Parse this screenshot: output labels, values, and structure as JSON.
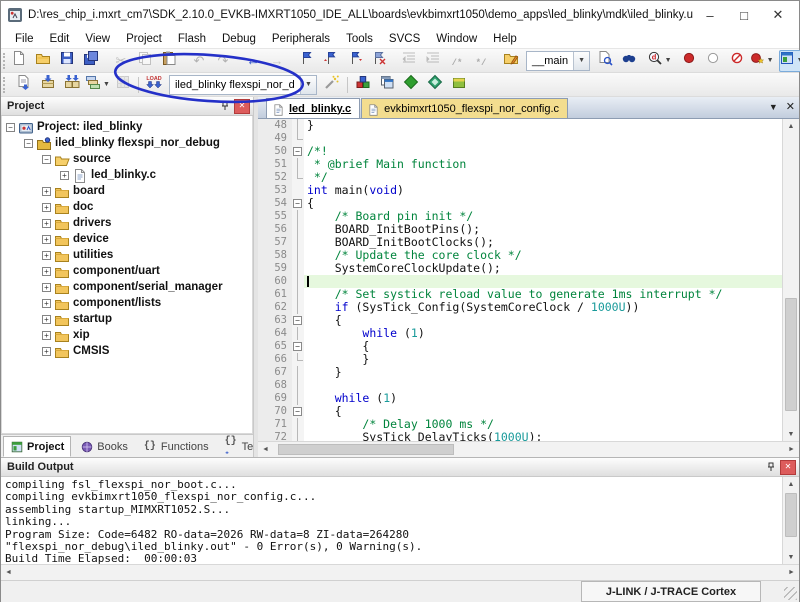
{
  "window": {
    "title": "D:\\res_chip_i.mxrt_cm7\\SDK_2.10.0_EVKB-IMXRT1050_IDE_ALL\\boards\\evkbimxrt1050\\demo_apps\\led_blinky\\mdk\\iled_blinky.uvprojx - µVision",
    "controls": [
      {
        "name": "minimize",
        "glyph": "–"
      },
      {
        "name": "maximize",
        "glyph": "□"
      },
      {
        "name": "close",
        "glyph": "✕"
      }
    ]
  },
  "menu": [
    "File",
    "Edit",
    "View",
    "Project",
    "Flash",
    "Debug",
    "Peripherals",
    "Tools",
    "SVCS",
    "Window",
    "Help"
  ],
  "toolbars": {
    "row1": [
      {
        "grip": 1
      },
      {
        "name": "new-file",
        "icon": "pageNew"
      },
      {
        "name": "open-file",
        "icon": "folderOpen"
      },
      {
        "name": "save",
        "icon": "floppy"
      },
      {
        "name": "save-all",
        "icon": "floppyAll"
      },
      {
        "sep": 1
      },
      {
        "name": "cut",
        "icon": "scissors",
        "disabled": 1
      },
      {
        "name": "copy",
        "icon": "copy",
        "disabled": 1
      },
      {
        "name": "paste",
        "icon": "paste"
      },
      {
        "sep": 1
      },
      {
        "name": "undo",
        "icon": "undo",
        "disabled": 1
      },
      {
        "name": "redo",
        "icon": "redo",
        "disabled": 1
      },
      {
        "sep": 1
      },
      {
        "name": "navigate-back",
        "icon": "navBack"
      },
      {
        "name": "navigate-forward",
        "icon": "navFwd",
        "disabled": 1
      },
      {
        "sep": 1
      },
      {
        "name": "toggle-bookmark",
        "icon": "flag"
      },
      {
        "name": "prev-bookmark",
        "icon": "flagPrev"
      },
      {
        "name": "next-bookmark",
        "icon": "flagNext"
      },
      {
        "name": "clear-bookmarks",
        "icon": "flagClear"
      },
      {
        "sep": 1
      },
      {
        "name": "outdent",
        "icon": "indentL",
        "disabled": 1
      },
      {
        "name": "indent",
        "icon": "indentR",
        "disabled": 1
      },
      {
        "name": "comment-selection",
        "icon": "commentOn",
        "disabled": 1
      },
      {
        "name": "uncomment-selection",
        "icon": "commentOff",
        "disabled": 1
      },
      {
        "sep": 1
      },
      {
        "name": "find-in-files-folder",
        "icon": "folderEdit"
      },
      {
        "combo": "find"
      },
      {
        "name": "find-next",
        "icon": "findPage"
      },
      {
        "name": "incremental-find",
        "icon": "binoc"
      },
      {
        "sep": 1
      },
      {
        "name": "find-in-files",
        "icon": "atFind",
        "dd": 1
      },
      {
        "sep": 1
      },
      {
        "name": "insert-breakpoint",
        "icon": "bpRed"
      },
      {
        "name": "enable-disable-breakpoint",
        "icon": "bpGray"
      },
      {
        "name": "disable-all-breakpoints",
        "icon": "bpDisable"
      },
      {
        "name": "kill-all-breakpoints",
        "icon": "bpKill",
        "dd": 1
      },
      {
        "sep": 1
      },
      {
        "name": "debug-windows",
        "icon": "winLayout",
        "hl": 1,
        "dd": 1
      },
      {
        "sep": 1
      },
      {
        "name": "configure",
        "icon": "wrench"
      }
    ],
    "row2": [
      {
        "grip": 1
      },
      {
        "name": "translate-file",
        "icon": "translate"
      },
      {
        "name": "build-target",
        "icon": "build"
      },
      {
        "name": "rebuild-all",
        "icon": "rebuild"
      },
      {
        "name": "batch-build",
        "icon": "batchBuild",
        "dd": 1
      },
      {
        "name": "stop-build",
        "icon": "stopBuild",
        "disabled": 1
      },
      {
        "sep": 1
      },
      {
        "name": "download-flash",
        "icon": "load"
      },
      {
        "combo": "target"
      },
      {
        "name": "options-for-target",
        "icon": "wand"
      },
      {
        "sep": 1
      },
      {
        "name": "manage-run-time-environment",
        "icon": "rte"
      },
      {
        "name": "manage-project-items",
        "icon": "layers"
      },
      {
        "name": "select-software-packs",
        "icon": "diamondGreen"
      },
      {
        "name": "pack-installer",
        "icon": "diamondTeal"
      },
      {
        "name": "manage-books",
        "icon": "boxGreen"
      }
    ]
  },
  "find_combo": {
    "value": "__main"
  },
  "target_combo": {
    "value": "iled_blinky flexspi_nor_d"
  },
  "annotation": {
    "shape": "ellipse",
    "color": "#2430c8"
  },
  "project_panel": {
    "title": "Project",
    "tree": [
      {
        "label": "Project: iled_blinky",
        "depth": 0,
        "icon": "target",
        "exp": "-"
      },
      {
        "label": "iled_blinky flexspi_nor_debug",
        "depth": 1,
        "icon": "folderTarget",
        "exp": "-"
      },
      {
        "label": "source",
        "depth": 2,
        "icon": "folderOpenT",
        "exp": "-"
      },
      {
        "label": "led_blinky.c",
        "depth": 3,
        "icon": "file",
        "exp": "+"
      },
      {
        "label": "board",
        "depth": 2,
        "icon": "folderT",
        "exp": "+"
      },
      {
        "label": "doc",
        "depth": 2,
        "icon": "folderT",
        "exp": "+"
      },
      {
        "label": "drivers",
        "depth": 2,
        "icon": "folderT",
        "exp": "+"
      },
      {
        "label": "device",
        "depth": 2,
        "icon": "folderT",
        "exp": "+"
      },
      {
        "label": "utilities",
        "depth": 2,
        "icon": "folderT",
        "exp": "+"
      },
      {
        "label": "component/uart",
        "depth": 2,
        "icon": "folderT",
        "exp": "+"
      },
      {
        "label": "component/serial_manager",
        "depth": 2,
        "icon": "folderT",
        "exp": "+"
      },
      {
        "label": "component/lists",
        "depth": 2,
        "icon": "folderT",
        "exp": "+"
      },
      {
        "label": "startup",
        "depth": 2,
        "icon": "folderT",
        "exp": "+"
      },
      {
        "label": "xip",
        "depth": 2,
        "icon": "folderT",
        "exp": "+"
      },
      {
        "label": "CMSIS",
        "depth": 2,
        "icon": "folderT",
        "exp": "+"
      }
    ],
    "tabs": [
      {
        "label": "Project",
        "icon": "tabProject",
        "active": true
      },
      {
        "label": "Books",
        "icon": "tabBooks",
        "active": false
      },
      {
        "label": "Functions",
        "icon": "tabFunctions",
        "active": false
      },
      {
        "label": "Templates",
        "icon": "tabTemplates",
        "active": false
      }
    ]
  },
  "editor": {
    "tabs": [
      {
        "label": "led_blinky.c",
        "active": true
      },
      {
        "label": "evkbimxrt1050_flexspi_nor_config.c",
        "active": false
      }
    ],
    "lines": [
      {
        "no": 48,
        "fold": "line",
        "seg": [
          [
            "}",
            ""
          ]
        ]
      },
      {
        "no": 49,
        "fold": "end",
        "seg": []
      },
      {
        "no": 50,
        "fold": "box",
        "seg": [
          [
            "/*!",
            "cm"
          ]
        ]
      },
      {
        "no": 51,
        "fold": "line",
        "seg": [
          [
            " * @brief Main function",
            "cm"
          ]
        ]
      },
      {
        "no": 52,
        "fold": "end",
        "seg": [
          [
            " */",
            "cm"
          ]
        ]
      },
      {
        "no": 53,
        "fold": "none",
        "seg": [
          [
            "int",
            "kw"
          ],
          [
            " main(",
            ""
          ],
          [
            "void",
            "kw"
          ],
          [
            ")",
            ""
          ]
        ]
      },
      {
        "no": 54,
        "fold": "box",
        "seg": [
          [
            "{",
            ""
          ]
        ]
      },
      {
        "no": 55,
        "fold": "line",
        "seg": [
          [
            "    ",
            ""
          ],
          [
            "/* Board pin init */",
            "cm"
          ]
        ]
      },
      {
        "no": 56,
        "fold": "line",
        "seg": [
          [
            "    BOARD_InitBootPins();",
            ""
          ]
        ]
      },
      {
        "no": 57,
        "fold": "line",
        "seg": [
          [
            "    BOARD_InitBootClocks();",
            ""
          ]
        ]
      },
      {
        "no": 58,
        "fold": "line",
        "seg": [
          [
            "    ",
            ""
          ],
          [
            "/* Update the core clock */",
            "cm"
          ]
        ]
      },
      {
        "no": 59,
        "fold": "line",
        "seg": [
          [
            "    SystemCoreClockUpdate();",
            ""
          ]
        ]
      },
      {
        "no": 60,
        "fold": "line",
        "seg": [],
        "highlight": true,
        "caret": true
      },
      {
        "no": 61,
        "fold": "line",
        "seg": [
          [
            "    ",
            ""
          ],
          [
            "/* Set systick reload value to generate 1ms interrupt */",
            "cm"
          ]
        ]
      },
      {
        "no": 62,
        "fold": "line",
        "seg": [
          [
            "    ",
            ""
          ],
          [
            "if",
            "kw"
          ],
          [
            " (SysTick_Config(SystemCoreClock / ",
            ""
          ],
          [
            "1000U",
            "num"
          ],
          [
            "))",
            ""
          ]
        ]
      },
      {
        "no": 63,
        "fold": "box",
        "seg": [
          [
            "    {",
            ""
          ]
        ]
      },
      {
        "no": 64,
        "fold": "line",
        "seg": [
          [
            "        ",
            ""
          ],
          [
            "while",
            "kw"
          ],
          [
            " (",
            ""
          ],
          [
            "1",
            "num"
          ],
          [
            ")",
            ""
          ]
        ]
      },
      {
        "no": 65,
        "fold": "box",
        "seg": [
          [
            "        {",
            ""
          ]
        ]
      },
      {
        "no": 66,
        "fold": "end",
        "seg": [
          [
            "        }",
            ""
          ]
        ]
      },
      {
        "no": 67,
        "fold": "line",
        "seg": [
          [
            "    }",
            ""
          ]
        ]
      },
      {
        "no": 68,
        "fold": "line",
        "seg": []
      },
      {
        "no": 69,
        "fold": "line",
        "seg": [
          [
            "    ",
            ""
          ],
          [
            "while",
            "kw"
          ],
          [
            " (",
            ""
          ],
          [
            "1",
            "num"
          ],
          [
            ")",
            ""
          ]
        ]
      },
      {
        "no": 70,
        "fold": "box",
        "seg": [
          [
            "    {",
            ""
          ]
        ]
      },
      {
        "no": 71,
        "fold": "line",
        "seg": [
          [
            "        ",
            ""
          ],
          [
            "/* Delay 1000 ms */",
            "cm"
          ]
        ]
      },
      {
        "no": 72,
        "fold": "line",
        "seg": [
          [
            "        SysTick_DelayTicks(",
            ""
          ],
          [
            "1000U",
            "num"
          ],
          [
            ");",
            ""
          ]
        ]
      }
    ]
  },
  "build_output": {
    "title": "Build Output",
    "lines": [
      "compiling fsl_flexspi_nor_boot.c...",
      "compiling evkbimxrt1050_flexspi_nor_config.c...",
      "assembling startup_MIMXRT1052.S...",
      "linking...",
      "Program Size: Code=6482 RO-data=2026 RW-data=8 ZI-data=264280",
      "\"flexspi_nor_debug\\iled_blinky.out\" - 0 Error(s), 0 Warning(s).",
      "Build Time Elapsed:  00:00:03"
    ]
  },
  "status_bar": {
    "right": "J-LINK / J-TRACE Cortex"
  }
}
